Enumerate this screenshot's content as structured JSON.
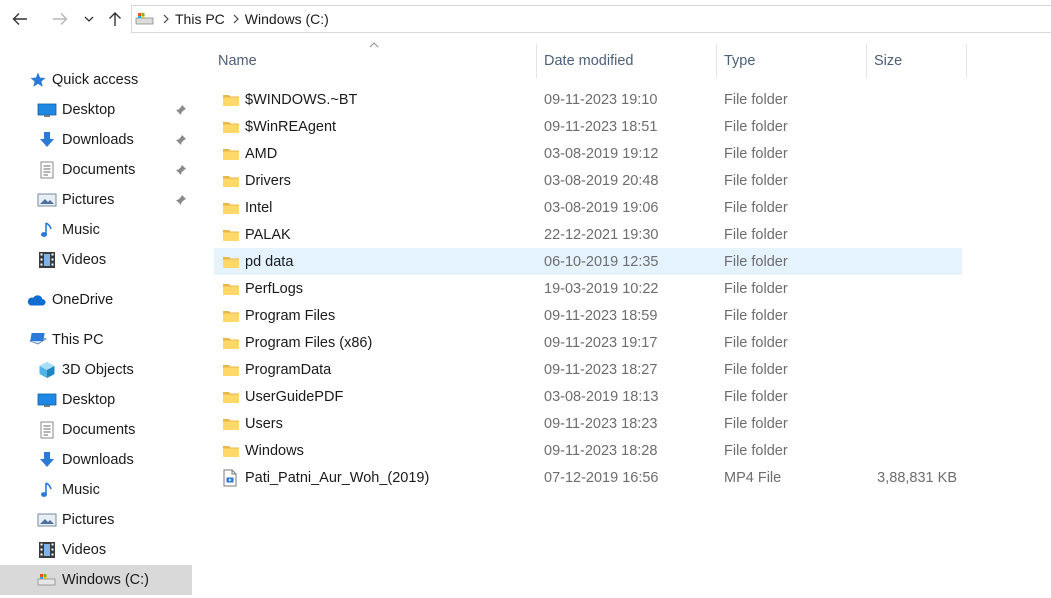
{
  "address": {
    "crumbs": [
      "This PC",
      "Windows (C:)"
    ]
  },
  "sidebar": {
    "quick_access": "Quick access",
    "quick_items": [
      {
        "label": "Desktop",
        "icon": "desktop-icon"
      },
      {
        "label": "Downloads",
        "icon": "downloads-icon"
      },
      {
        "label": "Documents",
        "icon": "documents-icon"
      },
      {
        "label": "Pictures",
        "icon": "pictures-icon"
      },
      {
        "label": "Music",
        "icon": "music-icon"
      },
      {
        "label": "Videos",
        "icon": "videos-icon"
      }
    ],
    "onedrive": "OneDrive",
    "this_pc": "This PC",
    "pc_items": [
      {
        "label": "3D Objects",
        "icon": "3d-objects-icon"
      },
      {
        "label": "Desktop",
        "icon": "desktop-icon"
      },
      {
        "label": "Documents",
        "icon": "documents-icon"
      },
      {
        "label": "Downloads",
        "icon": "downloads-icon"
      },
      {
        "label": "Music",
        "icon": "music-icon"
      },
      {
        "label": "Pictures",
        "icon": "pictures-icon"
      },
      {
        "label": "Videos",
        "icon": "videos-icon"
      },
      {
        "label": "Windows (C:)",
        "icon": "drive-icon"
      }
    ]
  },
  "columns": {
    "name": "Name",
    "date": "Date modified",
    "type": "Type",
    "size": "Size"
  },
  "files": [
    {
      "name": "$WINDOWS.~BT",
      "date": "09-11-2023 19:10",
      "type": "File folder",
      "size": "",
      "kind": "folder"
    },
    {
      "name": "$WinREAgent",
      "date": "09-11-2023 18:51",
      "type": "File folder",
      "size": "",
      "kind": "folder"
    },
    {
      "name": "AMD",
      "date": "03-08-2019 19:12",
      "type": "File folder",
      "size": "",
      "kind": "folder"
    },
    {
      "name": "Drivers",
      "date": "03-08-2019 20:48",
      "type": "File folder",
      "size": "",
      "kind": "folder"
    },
    {
      "name": "Intel",
      "date": "03-08-2019 19:06",
      "type": "File folder",
      "size": "",
      "kind": "folder"
    },
    {
      "name": "PALAK",
      "date": "22-12-2021 19:30",
      "type": "File folder",
      "size": "",
      "kind": "folder"
    },
    {
      "name": "pd data",
      "date": "06-10-2019 12:35",
      "type": "File folder",
      "size": "",
      "kind": "folder"
    },
    {
      "name": "PerfLogs",
      "date": "19-03-2019 10:22",
      "type": "File folder",
      "size": "",
      "kind": "folder"
    },
    {
      "name": "Program Files",
      "date": "09-11-2023 18:59",
      "type": "File folder",
      "size": "",
      "kind": "folder"
    },
    {
      "name": "Program Files (x86)",
      "date": "09-11-2023 19:17",
      "type": "File folder",
      "size": "",
      "kind": "folder"
    },
    {
      "name": "ProgramData",
      "date": "09-11-2023 18:27",
      "type": "File folder",
      "size": "",
      "kind": "folder"
    },
    {
      "name": "UserGuidePDF",
      "date": "03-08-2019 18:13",
      "type": "File folder",
      "size": "",
      "kind": "folder"
    },
    {
      "name": "Users",
      "date": "09-11-2023 18:23",
      "type": "File folder",
      "size": "",
      "kind": "folder"
    },
    {
      "name": "Windows",
      "date": "09-11-2023 18:28",
      "type": "File folder",
      "size": "",
      "kind": "folder"
    },
    {
      "name": "Pati_Patni_Aur_Woh_(2019)",
      "date": "07-12-2019 16:56",
      "type": "MP4 File",
      "size": "3,88,831 KB",
      "kind": "video"
    }
  ]
}
